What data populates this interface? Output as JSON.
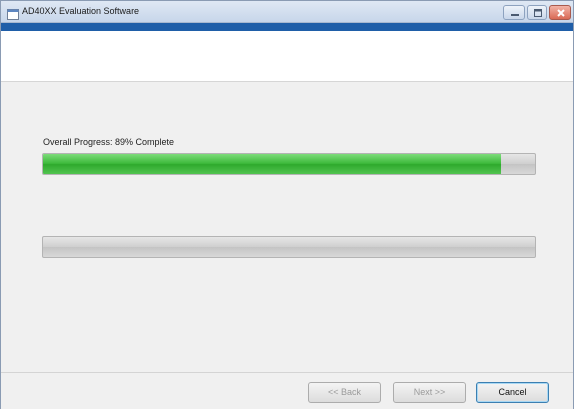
{
  "window": {
    "title": "AD40XX Evaluation Software"
  },
  "progress": {
    "overall_label": "Overall Progress: 89% Complete",
    "overall_fraction": 0.93,
    "secondary_fraction": 0.0
  },
  "footer": {
    "back_label": "<< Back",
    "next_label": "Next >>",
    "cancel_label": "Cancel"
  },
  "colors": {
    "title_band": "#1f5ea8",
    "progress_green": "#3cb93a"
  },
  "icons": {
    "app": "application-icon",
    "minimize": "minimize-icon",
    "maximize": "maximize-icon",
    "close": "close-icon"
  }
}
